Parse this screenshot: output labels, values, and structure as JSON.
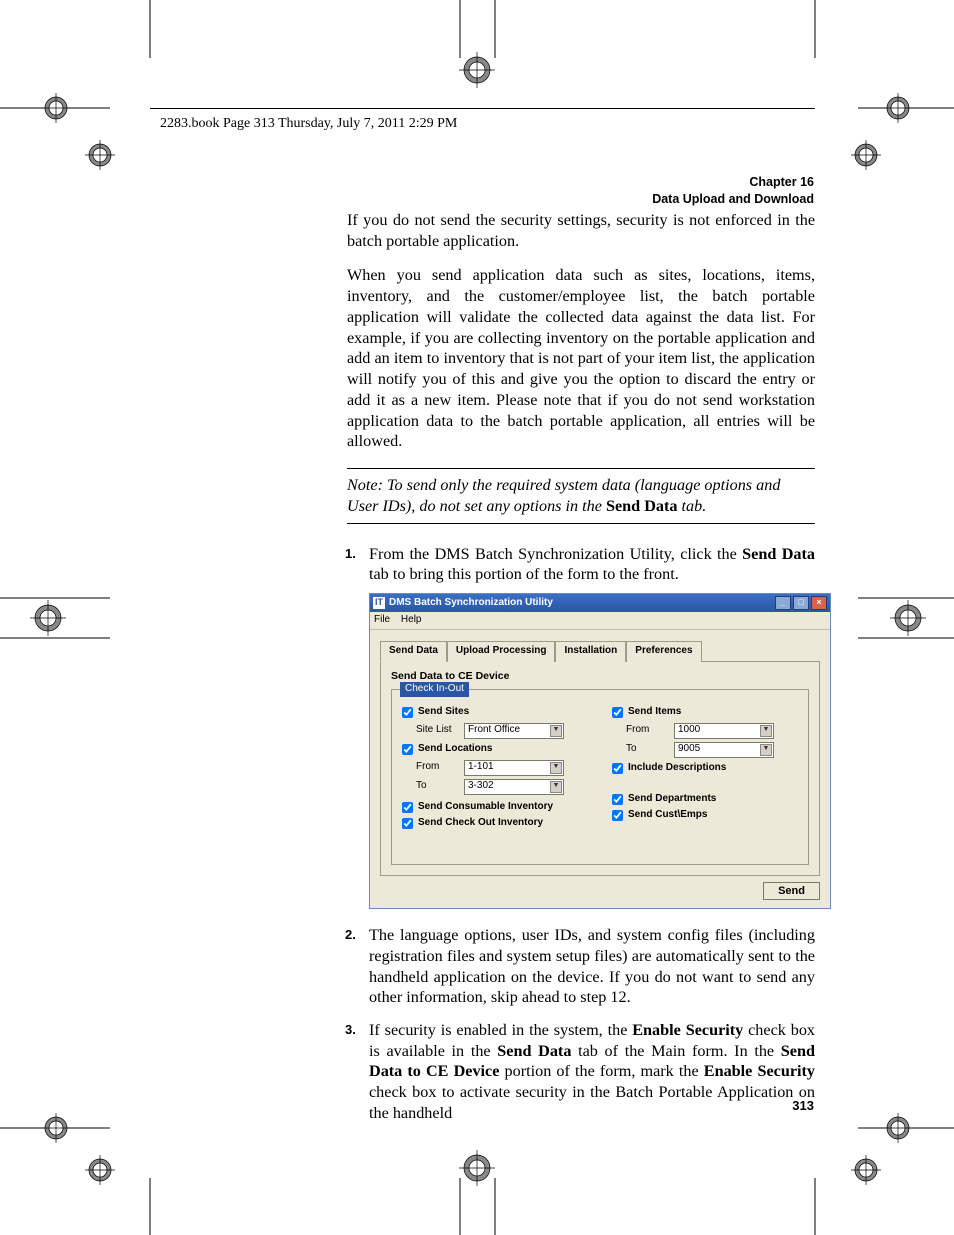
{
  "header_line": "2283.book  Page 313  Thursday, July 7, 2011  2:29 PM",
  "chapter": {
    "label": "Chapter 16",
    "title": "Data Upload and Download"
  },
  "para1": "If you do not send the security settings, security is not enforced in the batch portable application.",
  "para2": "When you send application data such as sites, locations, items, inventory, and the customer/employee list, the batch portable application will validate the collected data against the data list. For example, if you are collecting inventory on the portable application and add an item to inventory that is not part of your item list, the application will notify you of this and give you the option to discard the entry or add it as a new item. Please note that if you do not send workstation application data to the batch portable application, all entries will be allowed.",
  "note_prefix": "Note:   To send only the required system data (language options and User IDs), do not set any options in the ",
  "note_bold": "Send Data",
  "note_suffix": " tab.",
  "step1_a": "From the DMS Batch Synchronization Utility, click the ",
  "step1_b": "Send Data",
  "step1_c": " tab to bring this portion of the form to the front.",
  "step2": "The language options, user IDs, and system config files (including registration files and system setup files) are automatically sent to the handheld application on the device. If you do not want to send any other information, skip ahead to step 12.",
  "step3_a": "If security is enabled in the system, the ",
  "step3_b": "Enable Security",
  "step3_c": " check box is available in the ",
  "step3_d": "Send Data",
  "step3_e": " tab of the Main form. In the ",
  "step3_f": "Send Data to CE Device",
  "step3_g": " portion of the form, mark the ",
  "step3_h": "Enable Security",
  "step3_i": " check box to activate security in the Batch Portable Application on the handheld",
  "nums": {
    "s1": "1.",
    "s2": "2.",
    "s3": "3."
  },
  "page_number": "313",
  "app": {
    "title": "DMS Batch Synchronization Utility",
    "menu": {
      "file": "File",
      "help": "Help"
    },
    "tabs": {
      "t1": "Send Data",
      "t2": "Upload Processing",
      "t3": "Installation",
      "t4": "Preferences"
    },
    "section": "Send Data to CE Device",
    "legend": "Check In-Out",
    "left": {
      "send_sites": "Send Sites",
      "site_list_label": "Site List",
      "site_list_value": "Front Office",
      "send_locations": "Send Locations",
      "from_label": "From",
      "from_value": "1-101",
      "to_label": "To",
      "to_value": "3-302",
      "send_consumable": "Send Consumable Inventory",
      "send_checkout": "Send Check Out Inventory"
    },
    "right": {
      "send_items": "Send Items",
      "from_label": "From",
      "from_value": "1000",
      "to_label": "To",
      "to_value": "9005",
      "include_desc": "Include Descriptions",
      "send_departments": "Send Departments",
      "send_custemps": "Send Cust\\Emps"
    },
    "send_button": "Send"
  }
}
